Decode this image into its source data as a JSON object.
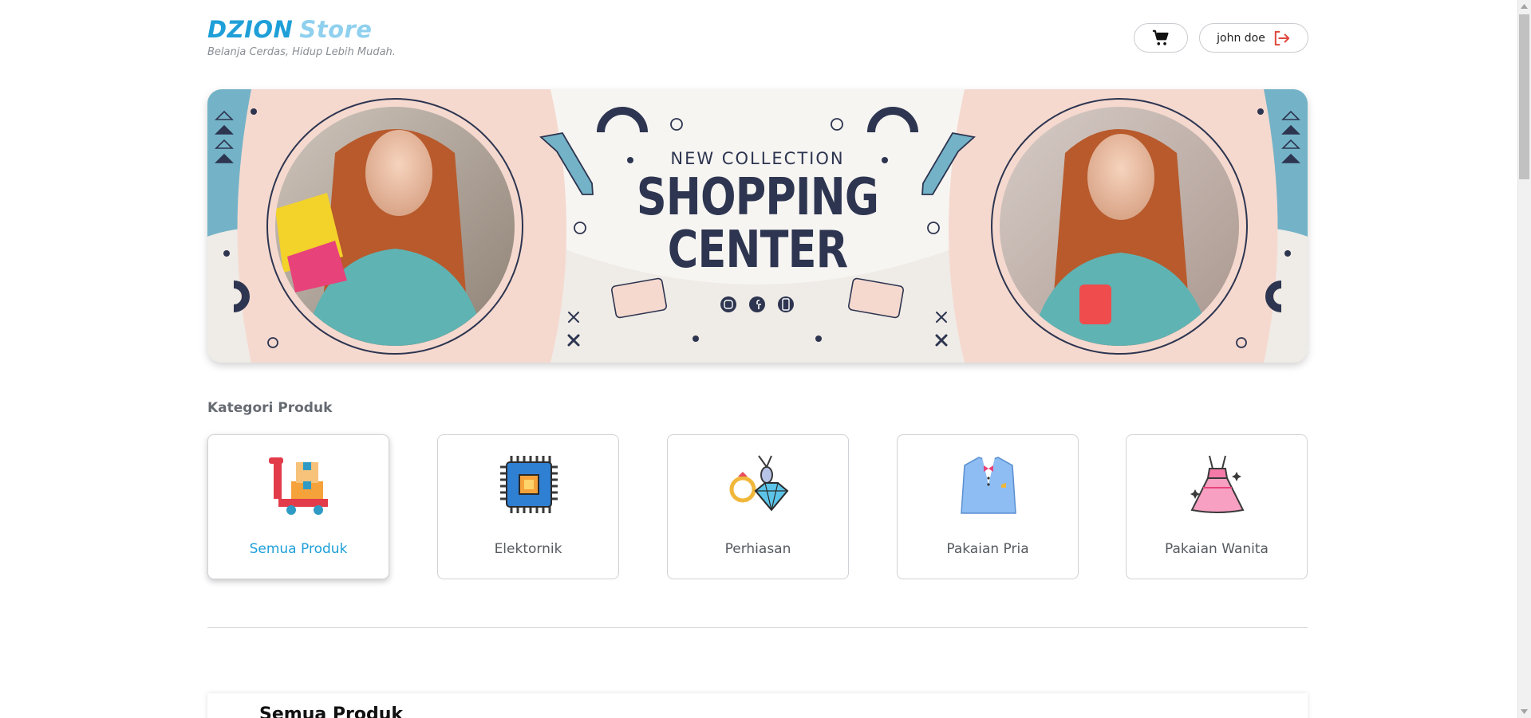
{
  "brand": {
    "name_part1": "DZION",
    "name_part2": "Store",
    "tagline": "Belanja Cerdas, Hidup Lebih Mudah."
  },
  "header": {
    "cart_icon": "shopping-cart-icon",
    "user_name": "john doe",
    "logout_icon": "logout-icon"
  },
  "banner": {
    "kicker": "NEW COLLECTION",
    "title_line1": "SHOPPING",
    "title_line2": "CENTER",
    "social_icons": [
      "instagram-icon",
      "facebook-icon",
      "phone-icon"
    ],
    "colors": {
      "teal": "#74b3c7",
      "peach": "#f5d9cf",
      "cream": "#efebe6",
      "navy": "#2d3550"
    }
  },
  "categories": {
    "title": "Kategori Produk",
    "items": [
      {
        "label": "Semua Produk",
        "icon": "cart-boxes-icon",
        "active": true
      },
      {
        "label": "Elektornik",
        "icon": "microchip-icon",
        "active": false
      },
      {
        "label": "Perhiasan",
        "icon": "jewelry-icon",
        "active": false
      },
      {
        "label": "Pakaian Pria",
        "icon": "suit-icon",
        "active": false
      },
      {
        "label": "Pakaian Wanita",
        "icon": "dress-icon",
        "active": false
      }
    ]
  },
  "products": {
    "title": "Semua Produk"
  },
  "colors": {
    "accent": "#1e9fd8",
    "accent_light": "#8fd0ee",
    "logout_red": "#e0463c"
  }
}
